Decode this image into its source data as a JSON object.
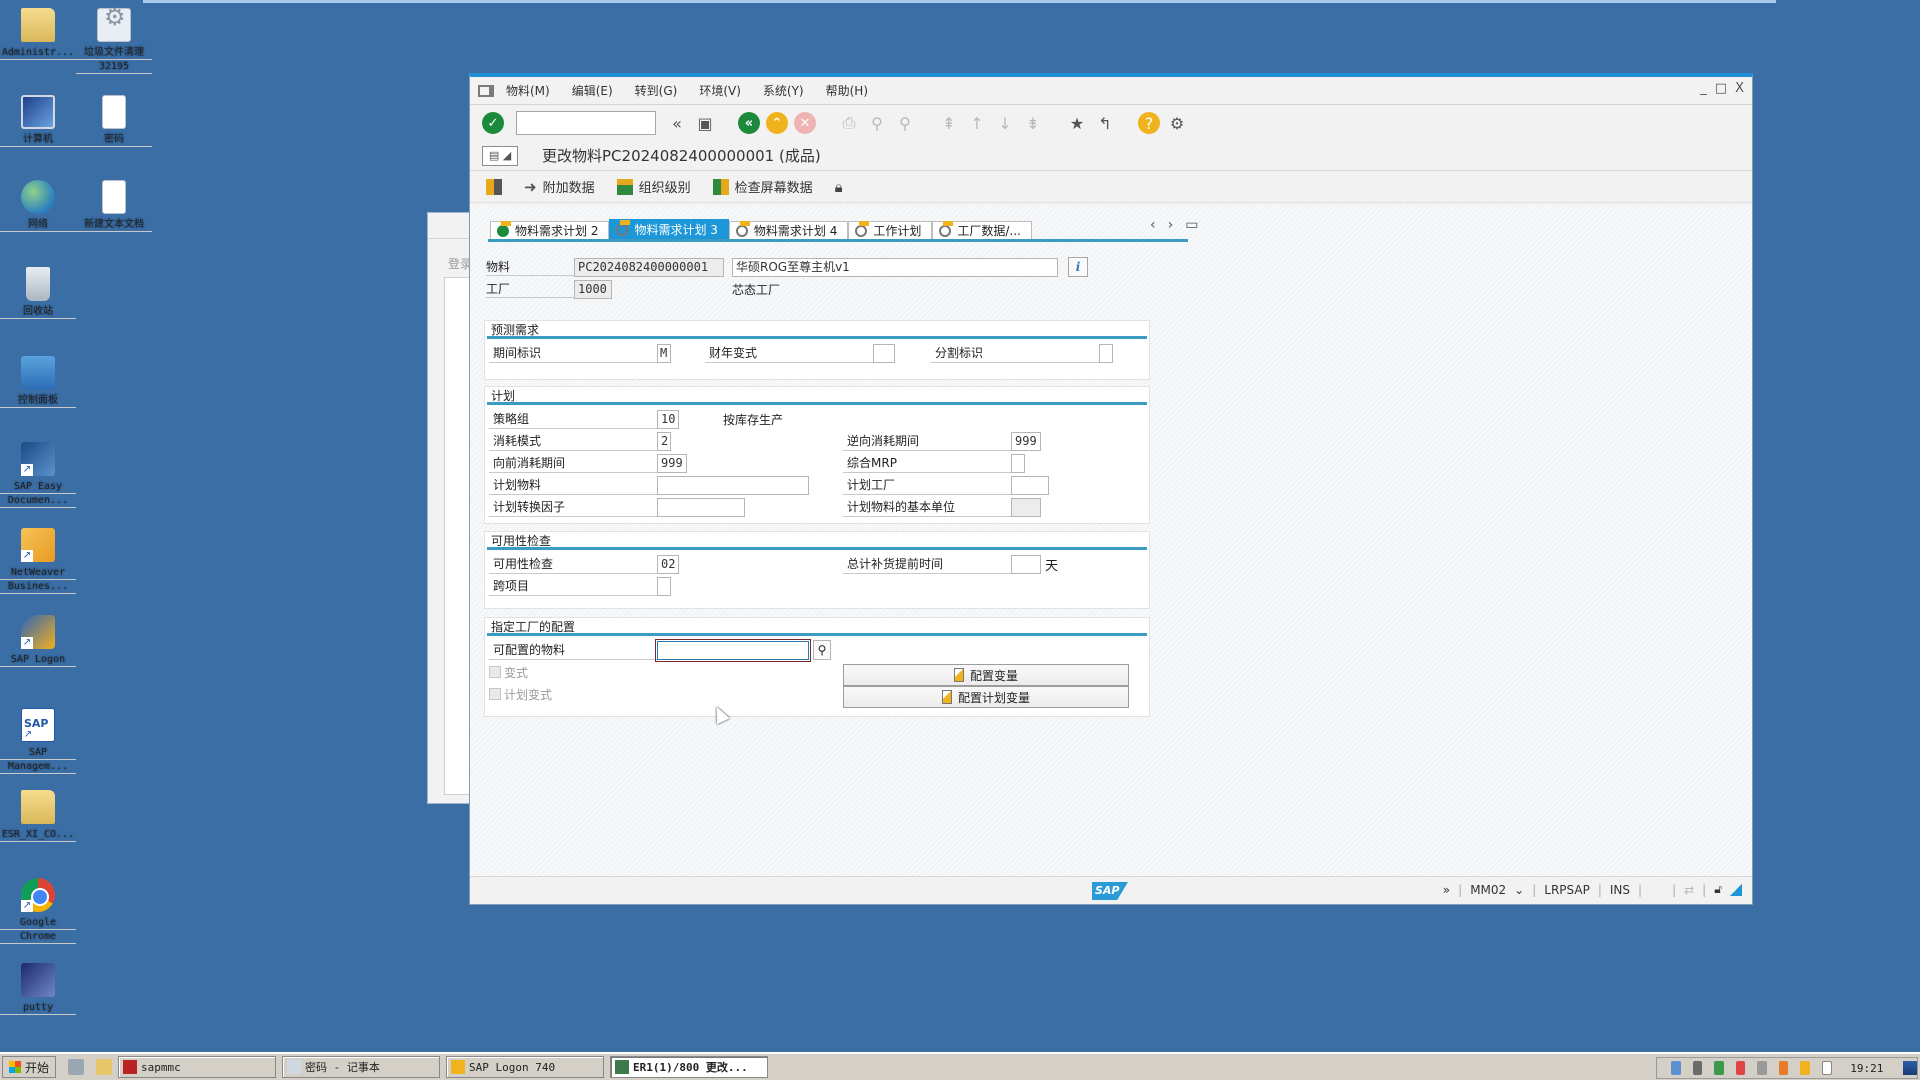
{
  "desktop": {
    "icons": [
      {
        "name": "administrator-folder",
        "label": "Administr..."
      },
      {
        "name": "junk-cleaner",
        "label": "垃圾文件清理",
        "sublabel": "32195"
      },
      {
        "name": "computer",
        "label": "计算机"
      },
      {
        "name": "password-doc",
        "label": "密码"
      },
      {
        "name": "network",
        "label": "网络"
      },
      {
        "name": "new-text-doc",
        "label": "新建文本文档"
      },
      {
        "name": "recycle-bin",
        "label": "回收站"
      },
      {
        "name": "control-panel",
        "label": "控制面板"
      },
      {
        "name": "sap-easy-doc",
        "label": "SAP Easy",
        "sublabel": "Documen..."
      },
      {
        "name": "netweaver",
        "label": "NetWeaver",
        "sublabel": "Busines..."
      },
      {
        "name": "sap-logon",
        "label": "SAP Logon"
      },
      {
        "name": "sap-management",
        "label": "SAP",
        "sublabel": "Managem..."
      },
      {
        "name": "esr-folder",
        "label": "ESR_XI_CO..."
      },
      {
        "name": "google-chrome",
        "label": "Google",
        "sublabel": "Chrome"
      },
      {
        "name": "putty",
        "label": "putty"
      }
    ]
  },
  "background_window": {
    "label": "登录"
  },
  "sap": {
    "menu": [
      "物料(M)",
      "编辑(E)",
      "转到(G)",
      "环境(V)",
      "系统(Y)",
      "帮助(H)"
    ],
    "window_controls": {
      "minimize": "_",
      "maximize": "□",
      "close": "X"
    },
    "command_field": {
      "value": "",
      "placeholder": ""
    },
    "title": "更改物料PC2024082400000001 (成品)",
    "app_toolbar": [
      {
        "icon": "expand-icon",
        "label": ""
      },
      {
        "icon": "arrow-right-icon",
        "label": "附加数据"
      },
      {
        "icon": "org-levels-icon",
        "label": "组织级别"
      },
      {
        "icon": "check-screen-icon",
        "label": "检查屏幕数据"
      },
      {
        "icon": "lock-icon",
        "label": ""
      }
    ],
    "tabs": [
      {
        "label": "物料需求计划 2",
        "active": false,
        "status": "ok"
      },
      {
        "label": "物料需求计划 3",
        "active": true,
        "status": "pending"
      },
      {
        "label": "物料需求计划 4",
        "active": false,
        "status": "pending"
      },
      {
        "label": "工作计划",
        "active": false,
        "status": "pending"
      },
      {
        "label": "工厂数据/...",
        "active": false,
        "status": "pending"
      }
    ],
    "header": {
      "material_label": "物料",
      "material_value": "PC2024082400000001",
      "material_desc": "华硕ROG至尊主机v1",
      "plant_label": "工厂",
      "plant_value": "1000",
      "plant_desc": "芯态工厂"
    },
    "forecast": {
      "title": "预测需求",
      "period_indicator_label": "期间标识",
      "period_indicator_value": "M",
      "fiscal_year_variant_label": "财年变式",
      "fiscal_year_variant_value": "",
      "splitting_indicator_label": "分割标识",
      "splitting_indicator_value": ""
    },
    "planning": {
      "title": "计划",
      "strategy_group_label": "策略组",
      "strategy_group_value": "10",
      "strategy_group_desc": "按库存生产",
      "consumption_mode_label": "消耗模式",
      "consumption_mode_value": "2",
      "bwd_consumption_label": "逆向消耗期间",
      "bwd_consumption_value": "999",
      "fwd_consumption_label": "向前消耗期间",
      "fwd_consumption_value": "999",
      "mixed_mrp_label": "综合MRP",
      "mixed_mrp_value": "",
      "planning_material_label": "计划物料",
      "planning_material_value": "",
      "planning_plant_label": "计划工厂",
      "planning_plant_value": "",
      "conv_factor_label": "计划转换因子",
      "conv_factor_value": "",
      "planning_base_unit_label": "计划物料的基本单位",
      "planning_base_unit_value": ""
    },
    "availability": {
      "title": "可用性检查",
      "check_label": "可用性检查",
      "check_value": "02",
      "total_repl_lead_label": "总计补货提前时间",
      "total_repl_lead_value": "",
      "days_unit": "天",
      "cross_project_label": "跨项目",
      "cross_project_value": ""
    },
    "plant_config": {
      "title": "指定工厂的配置",
      "configurable_material_label": "可配置的物料",
      "configurable_material_value": "",
      "variant_label": "变式",
      "planning_variant_label": "计划变式",
      "config_variant_button": "配置变量",
      "config_planning_variant_button": "配置计划变量"
    },
    "status_bar": {
      "expand": "»",
      "transaction": "MM02",
      "system": "LRPSAP",
      "mode": "INS",
      "logo": "SAP"
    }
  },
  "taskbar": {
    "start_label": "开始",
    "tasks": [
      {
        "label": "sapmmc",
        "active": false
      },
      {
        "label": "密码 - 记事本",
        "active": false
      },
      {
        "label": "SAP Logon 740",
        "active": false
      },
      {
        "label": "ER1(1)/800 更改...",
        "active": true
      }
    ],
    "clock": "19:21"
  }
}
